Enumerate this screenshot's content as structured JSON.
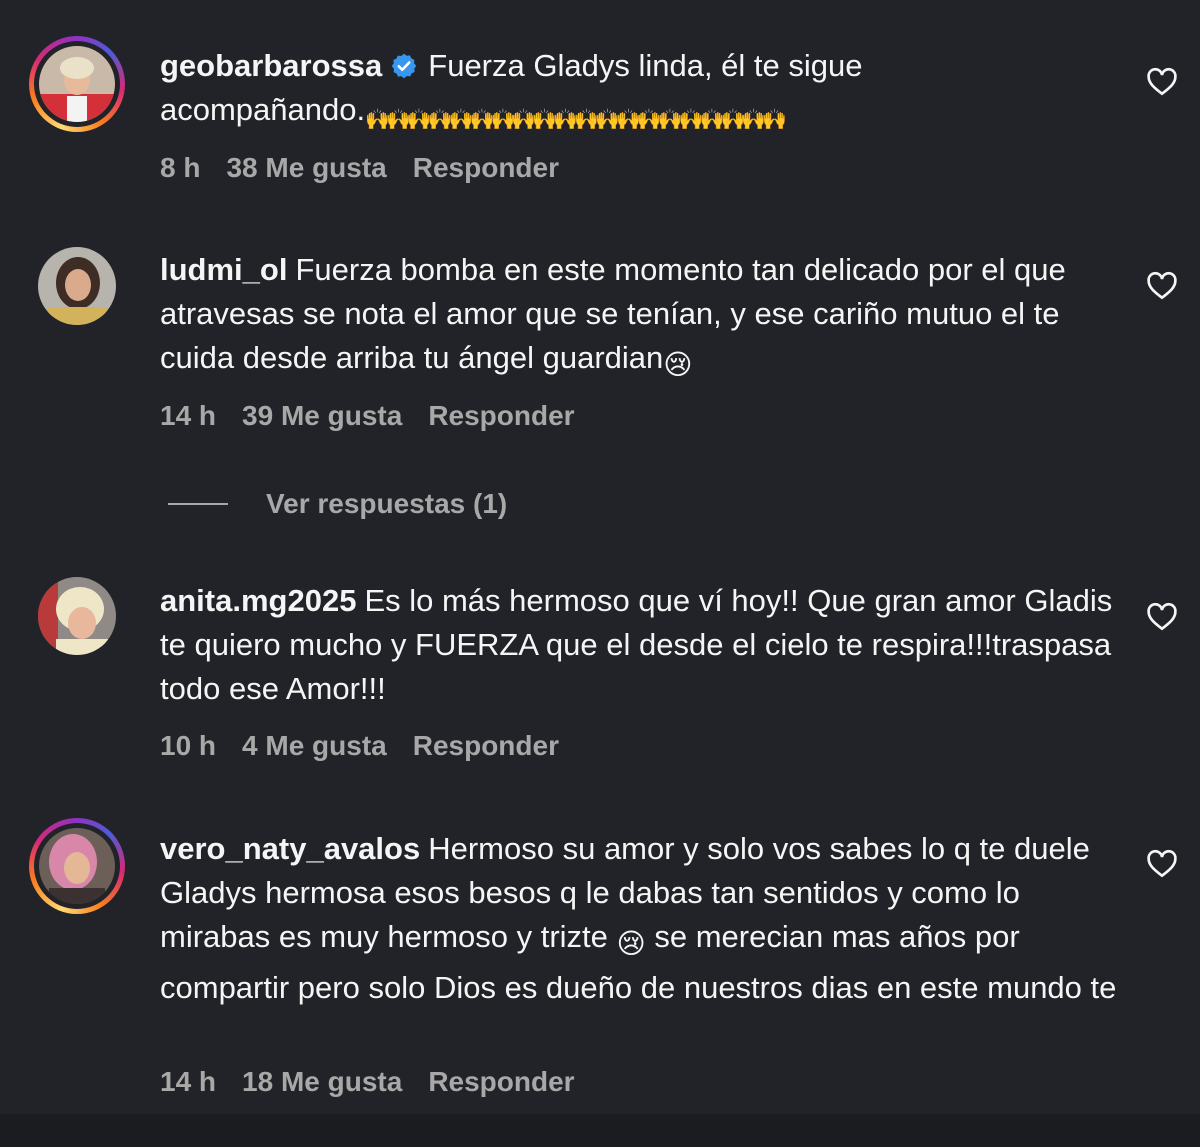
{
  "comments": [
    {
      "username": "geobarbarossa",
      "verified": true,
      "text_line1": "Fuerza Gladys linda, él te sigue",
      "text_line2": "acompañando.",
      "emoji": "🙌🙌🙌🙌🙌🙌🙌🙌🙌🙌🙌🙌🙌🙌🙌🙌🙌🙌🙌🙌",
      "time": "8 h",
      "likes": "38 Me gusta",
      "reply": "Responder",
      "avatar_ring": true
    },
    {
      "username": "ludmi_ol",
      "verified": false,
      "text": "Fuerza bomba en este momento tan delicado por el que atravesas se nota el amor que se tenían, y ese cariño mutuo el te cuida desde arriba tu ángel guardian",
      "emoji": "😢",
      "time": "14 h",
      "likes": "39 Me gusta",
      "reply": "Responder",
      "avatar_ring": false
    },
    {
      "username": "anita.mg2025",
      "verified": false,
      "text": "Es lo más hermoso que ví hoy!! Que gran amor Gladis te quiero mucho y FUERZA que el desde el cielo te respira!!!traspasa todo ese Amor!!!",
      "time": "10 h",
      "likes": "4 Me gusta",
      "reply": "Responder",
      "avatar_ring": false
    },
    {
      "username": "vero_naty_avalos",
      "verified": false,
      "text_before_emoji": "Hermoso su amor y solo vos sabes lo q te duele Gladys hermosa esos besos q le dabas tan sentidos y como lo mirabas es muy hermoso y trizte",
      "emoji": "😢",
      "text_after_emoji": "se merecian mas años por compartir pero solo Dios es dueño de nuestros dias en este mundo te",
      "time": "14 h",
      "likes": "18 Me gusta",
      "reply": "Responder",
      "avatar_ring": true
    }
  ],
  "view_replies": "Ver respuestas (1)",
  "icons": {
    "like": "heart-outline-icon",
    "verified": "verified-badge-icon"
  },
  "colors": {
    "background": "#212328",
    "text": "#f5f5f5",
    "meta": "#a8a8a8",
    "verified": "#3797f0"
  }
}
